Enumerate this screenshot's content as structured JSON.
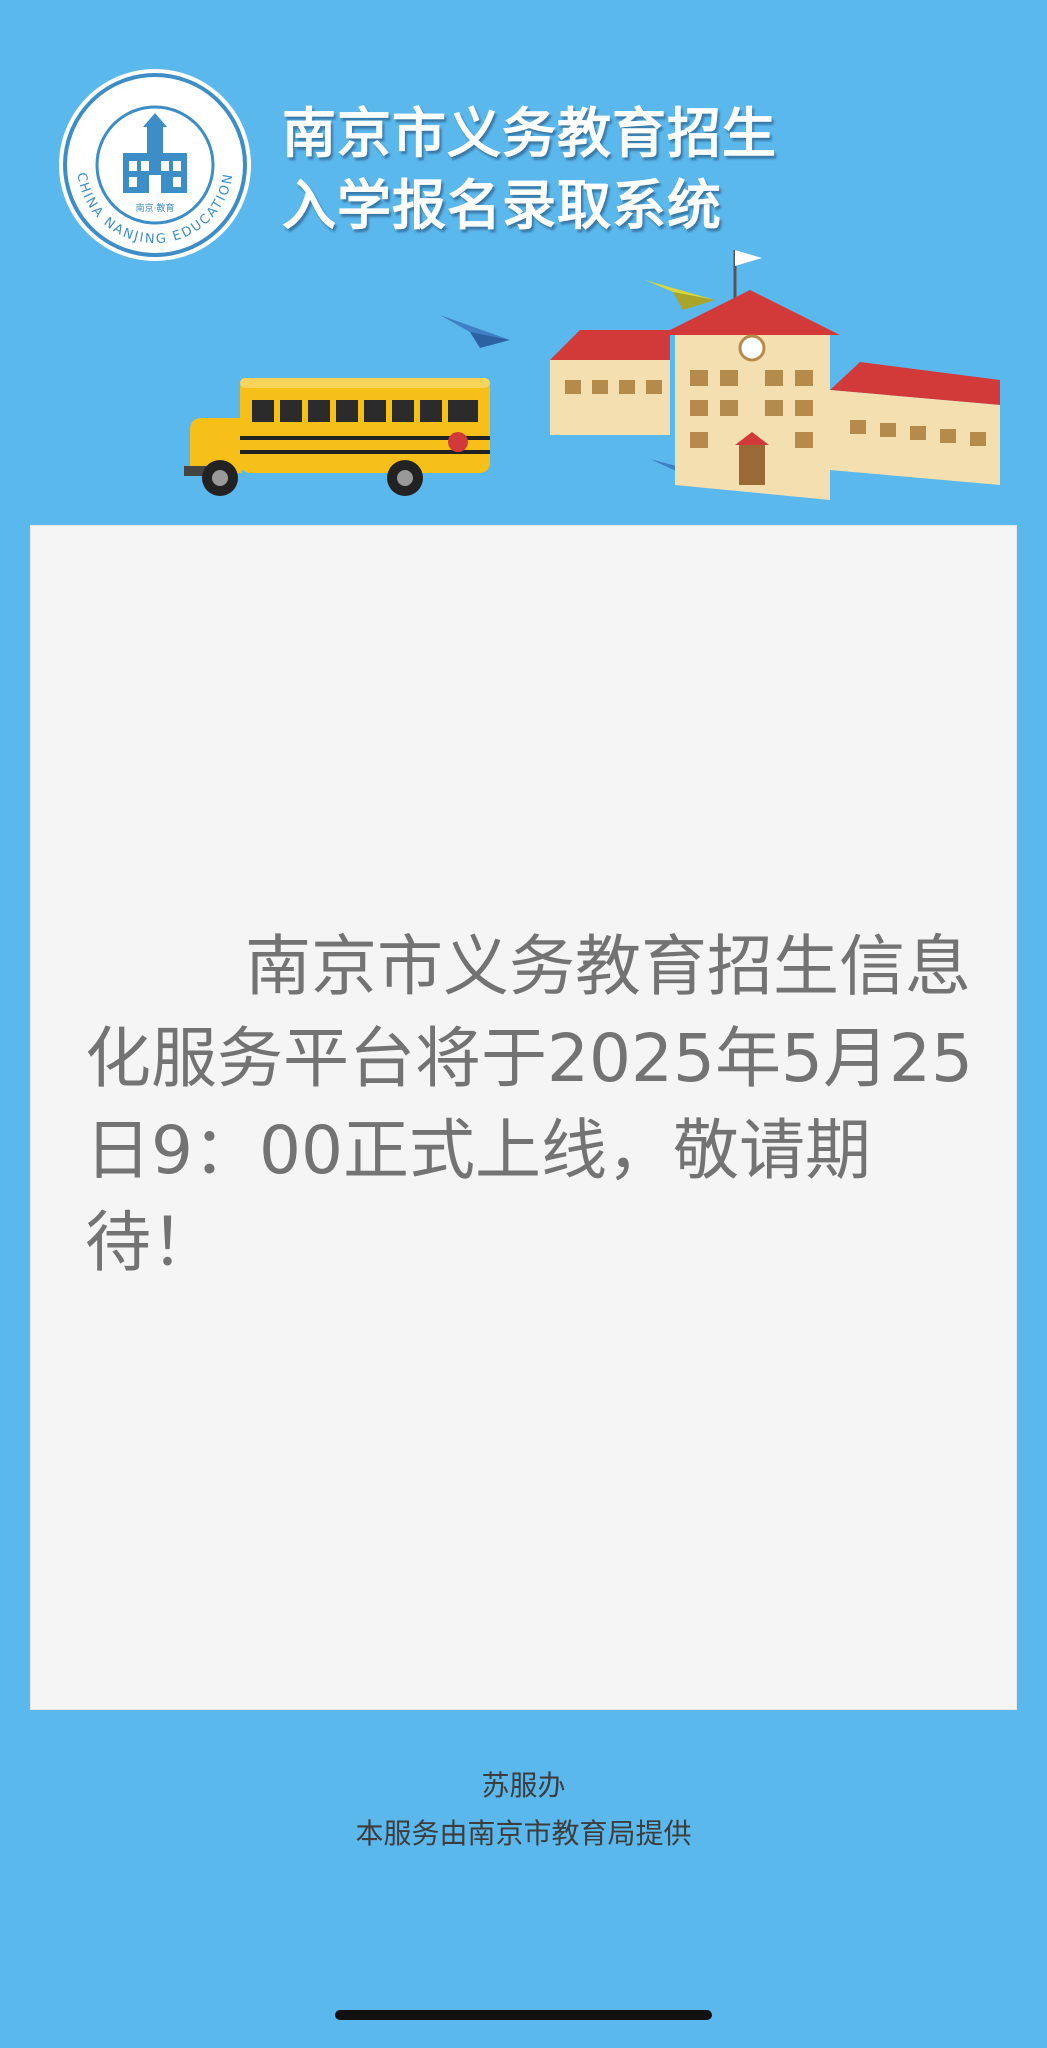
{
  "header": {
    "title_line1": "南京市义务教育招生",
    "title_line2": "入学报名录取系统",
    "logo_text_en": "CHINA NANJING EDUCATION",
    "logo_text_cn": "南京·教育"
  },
  "notice": {
    "text": "南京市义务教育招生信息化服务平台将于2025年5月25日9：00正式上线，敬请期待！"
  },
  "footer": {
    "line1": "苏服办",
    "line2": "本服务由南京市教育局提供"
  },
  "icons": {
    "logo": "nanjing-education-seal-icon",
    "bus": "school-bus-icon",
    "school": "school-building-icon",
    "plane": "paper-plane-icon"
  },
  "colors": {
    "background": "#5bb8ec",
    "card": "#f5f5f5",
    "notice_text": "#737373",
    "roof": "#d23a3a",
    "bus": "#f6c018"
  }
}
